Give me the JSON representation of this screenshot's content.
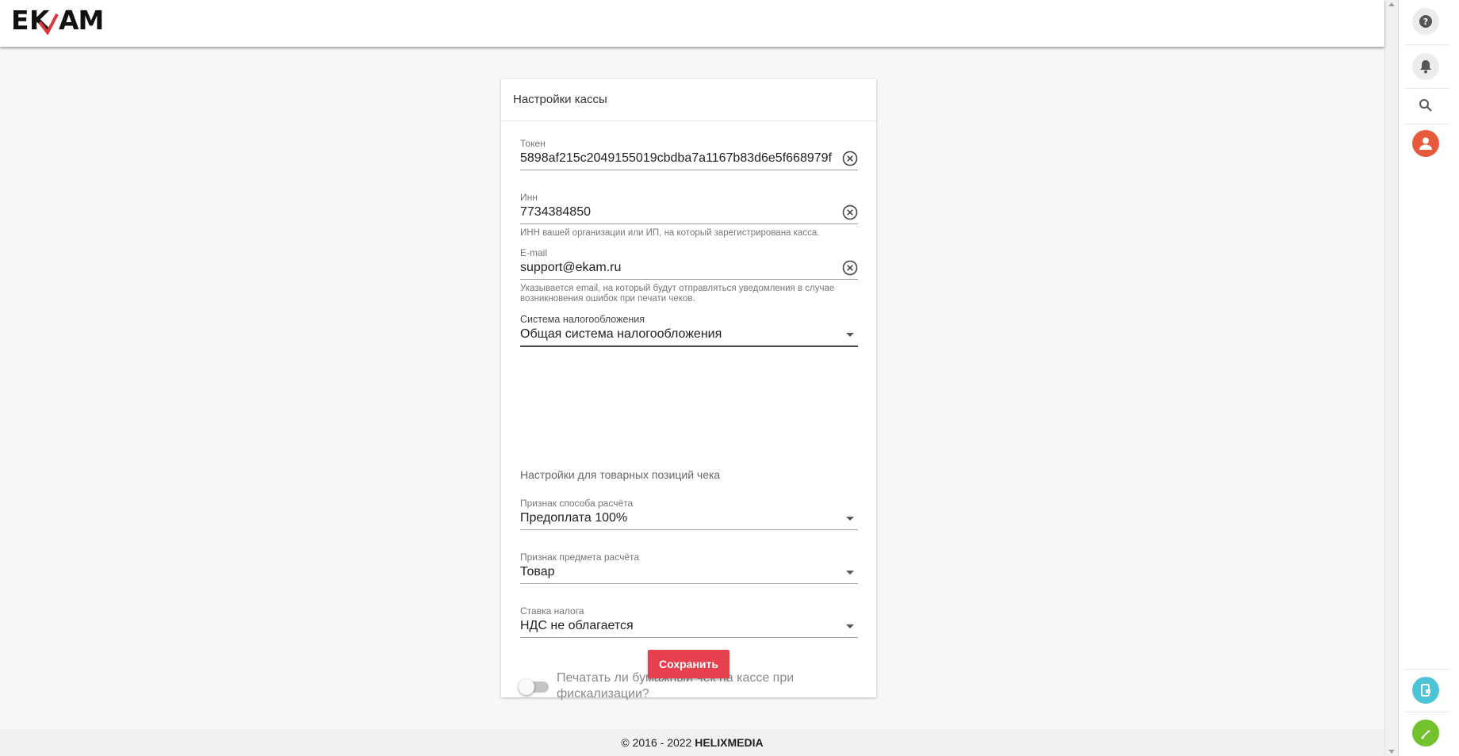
{
  "header": {
    "logo_text": "EKAM"
  },
  "right_panel": {
    "icons": [
      "help-icon",
      "bell-icon",
      "search-icon",
      "user-avatar-icon",
      "mobile-device-icon",
      "phone-icon"
    ],
    "colors": {
      "avatar": "#e85a3c",
      "device": "#4cc3d6",
      "phone": "#74c12e"
    }
  },
  "card": {
    "title": "Настройки кассы",
    "token": {
      "label": "Токен",
      "value": "5898af215c2049155019cbdba7a1167b83d6e5f668979f"
    },
    "inn": {
      "label": "Инн",
      "value": "7734384850",
      "hint": "ИНН вашей организации или ИП, на который зарегистрирована касса."
    },
    "email": {
      "label": "E-mail",
      "value": "support@ekam.ru",
      "hint": "Указывается email, на который будут отправляться уведомления в случае возникновения ошибок при печати чеков."
    },
    "tax_system": {
      "label": "Система налогообложения",
      "value": "Общая система налогообложения"
    },
    "section_title": "Настройки для товарных позиций чека",
    "payment_method": {
      "label": "Признак способа расчёта",
      "value": "Предоплата 100%"
    },
    "payment_subject": {
      "label": "Признак предмета расчёта",
      "value": "Товар"
    },
    "tax_rate": {
      "label": "Ставка налога",
      "value": "НДС не облагается"
    },
    "print_toggle": {
      "label": "Печатать ли бумажный чек на кассе при фискализации?",
      "checked": false
    },
    "save_label": "Сохранить"
  },
  "footer": {
    "copyright": "© 2016 - 2022",
    "company": "HELIXMEDIA"
  },
  "colors": {
    "accent": "#e8404f"
  }
}
